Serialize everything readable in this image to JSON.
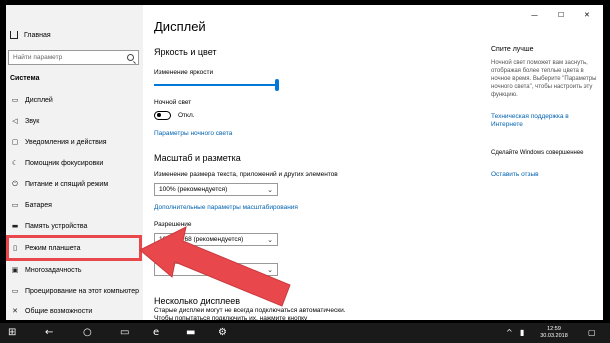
{
  "colors": {
    "accent": "#0078d7",
    "link": "#0063b1",
    "highlight": "#e8474b",
    "sidebar_bg": "#f2f2f2",
    "taskbar_bg": "#1a1a1a"
  },
  "sidebar": {
    "home": {
      "label": "Главная",
      "icon": "home-icon"
    },
    "search": {
      "placeholder": "Найти параметр",
      "icon": "search-icon"
    },
    "section": "Система",
    "items": [
      {
        "label": "Дисплей",
        "icon": "monitor-icon"
      },
      {
        "label": "Звук",
        "icon": "speaker-icon"
      },
      {
        "label": "Уведомления и действия",
        "icon": "notification-icon"
      },
      {
        "label": "Помощник фокусировки",
        "icon": "moon-icon"
      },
      {
        "label": "Питание и спящий режим",
        "icon": "power-icon"
      },
      {
        "label": "Батарея",
        "icon": "battery-icon"
      },
      {
        "label": "Память устройства",
        "icon": "storage-icon"
      },
      {
        "label": "Режим планшета",
        "icon": "tablet-icon"
      },
      {
        "label": "Многозадачность",
        "icon": "multitask-icon"
      },
      {
        "label": "Проецирование на этот компьютер",
        "icon": "project-icon"
      },
      {
        "label": "Общие возможности",
        "icon": "shared-icon"
      }
    ]
  },
  "main": {
    "title": "Дисплей",
    "brightness": {
      "heading": "Яркость и цвет",
      "slider_label": "Изменение яркости",
      "level": 1.0
    },
    "night_light": {
      "label": "Ночной свет",
      "state": "Откл.",
      "settings_link": "Параметры ночного света"
    },
    "scale": {
      "heading": "Масштаб и разметка",
      "size_label": "Изменение размера текста, приложений и других элементов",
      "size_value": "100% (рекомендуется)",
      "advanced_link": "Дополнительные параметры масштабирования",
      "resolution_label": "Разрешение",
      "resolution_value": "1366 × 768 (рекомендуется)"
    },
    "multi": {
      "heading": "Несколько дисплеев",
      "text": "Старые дисплеи могут не всегда подключаться автоматически. Чтобы попытаться подключить их, нажмите кнопку"
    }
  },
  "right": {
    "title": "Спите лучше",
    "text": "Ночной свет поможет вам заснуть, отображая более теплые цвета в ночное время. Выберите \"Параметры ночного света\", чтобы настроить эту функцию.",
    "link1": "Техническая поддержка в Интернете",
    "text2": "Сделайте Windows совершеннее",
    "link2": "Оставить отзыв"
  },
  "window_controls": {
    "minimize": "—",
    "maximize": "☐",
    "close": "✕"
  },
  "taskbar": {
    "icons": [
      "windows-icon",
      "back-icon",
      "search-icon",
      "task-view-icon",
      "edge-icon",
      "explorer-icon",
      "settings-icon"
    ],
    "time": "12:59",
    "date": "30.03.2018"
  }
}
